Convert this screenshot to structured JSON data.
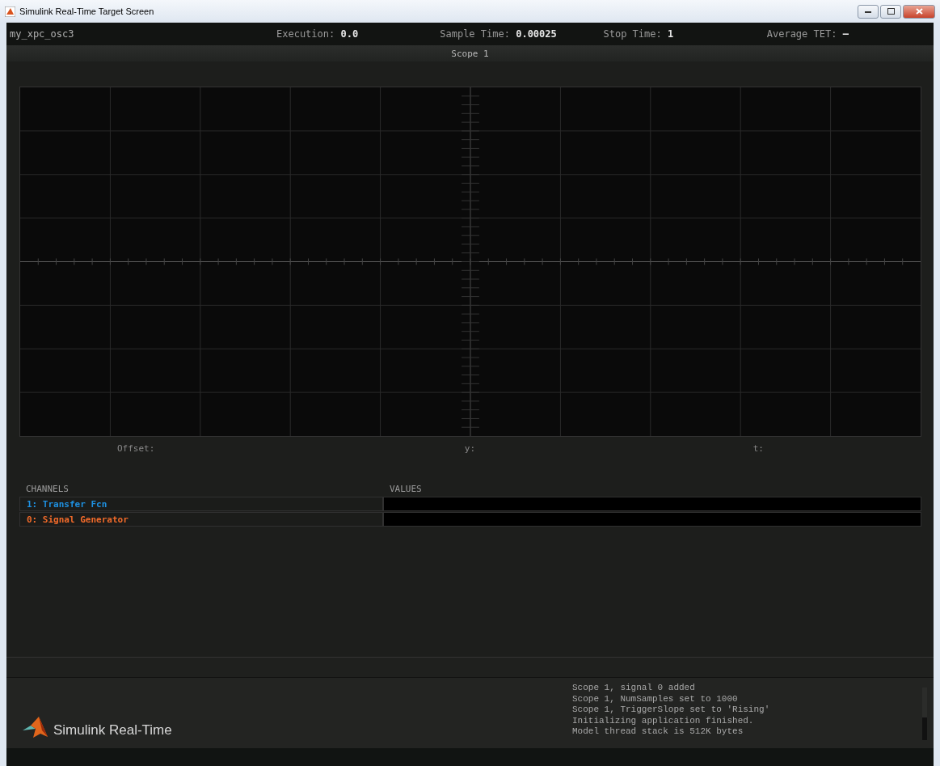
{
  "window": {
    "title": "Simulink Real-Time Target Screen"
  },
  "header": {
    "model": "my_xpc_osc3",
    "stats": [
      {
        "label": "Execution:",
        "value": "0.0"
      },
      {
        "label": "Sample Time:",
        "value": "0.00025"
      },
      {
        "label": "Stop Time:",
        "value": "1"
      },
      {
        "label": "Average TET:",
        "value": "–"
      }
    ]
  },
  "scope": {
    "title": "Scope 1",
    "readouts": [
      "Offset:",
      "y:",
      "t:"
    ]
  },
  "channels": {
    "headers": [
      "CHANNELS",
      "VALUES"
    ],
    "rows": [
      {
        "name": "1: Transfer Fcn",
        "color": "#1e90e0"
      },
      {
        "name": "0: Signal Generator",
        "color": "#f06a2a"
      }
    ]
  },
  "footer": {
    "brand": "Simulink Real-Time",
    "log": [
      "Scope 1, signal 0 added",
      "Scope 1, NumSamples set to 1000",
      "Scope 1, TriggerSlope set to 'Rising'",
      "Initializing application finished.",
      "Model thread stack is 512K bytes"
    ]
  }
}
